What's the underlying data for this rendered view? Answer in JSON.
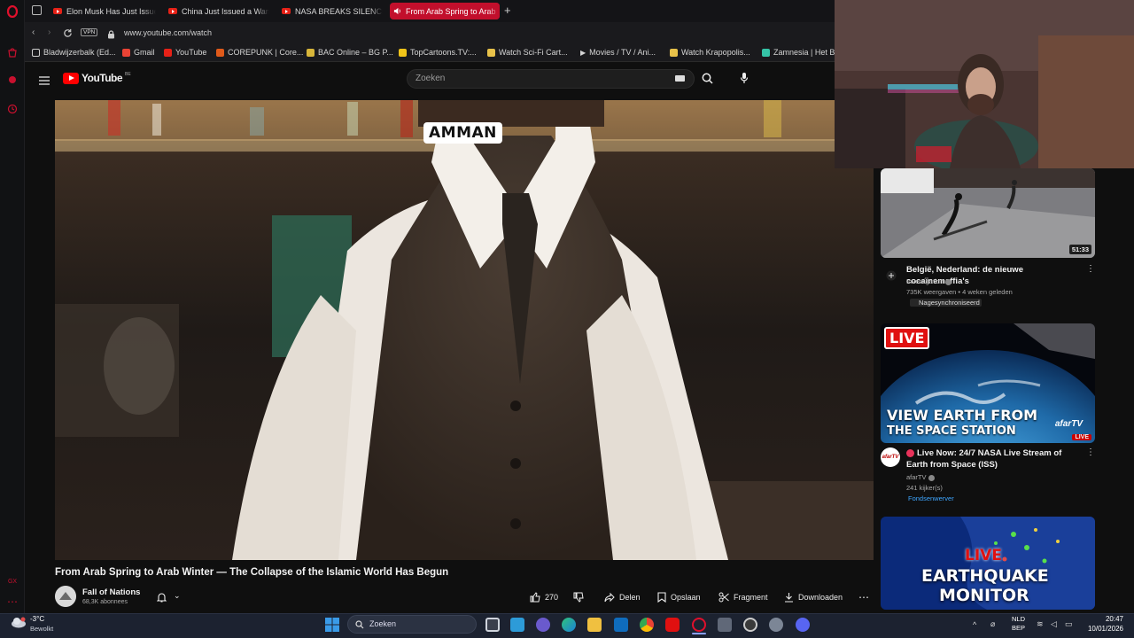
{
  "browser": {
    "tabs": [
      {
        "label": "Elon Musk Has Just Issued",
        "active": false
      },
      {
        "label": "China Just Issued a Warning",
        "active": false
      },
      {
        "label": "NASA BREAKS SILENCE on",
        "active": false
      },
      {
        "label": "From Arab Spring to Arab",
        "active": true
      }
    ],
    "vpn_label": "VPN",
    "url": "www.youtube.com/watch",
    "bookmarks": [
      {
        "label": "Bladwijzerbalk (Ed...",
        "icon": "folder-icon",
        "color": "#cfcfcf"
      },
      {
        "label": "Gmail",
        "icon": "gmail-icon",
        "color": "#ea4335"
      },
      {
        "label": "YouTube",
        "icon": "youtube-icon",
        "color": "#e62117"
      },
      {
        "label": "COREPUNK | Core...",
        "icon": "corepunk-icon",
        "color": "#e05a1a"
      },
      {
        "label": "BAC Online – BG P...",
        "icon": "bac-icon",
        "color": "#d8b63a"
      },
      {
        "label": "TopCartoons.TV:...",
        "icon": "topcartoons-icon",
        "color": "#f0c419"
      },
      {
        "label": "Watch Sci-Fi Cart...",
        "icon": "scifi-icon",
        "color": "#e8c24a"
      },
      {
        "label": "Movies / TV / Ani...",
        "icon": "play-icon",
        "color": "#f1f1f1"
      },
      {
        "label": "Watch Krapopolis...",
        "icon": "krapopolis-icon",
        "color": "#e8c24a"
      },
      {
        "label": "Zamnesia | Het Be",
        "icon": "zamnesia-icon",
        "color": "#35c4a7"
      }
    ]
  },
  "youtube": {
    "logo_text": "YouTube",
    "region_code": "BE",
    "search_placeholder": "Zoeken"
  },
  "video": {
    "overlay_text": "AMMAN",
    "title": "From Arab Spring to Arab Winter — The Collapse of the Islamic World Has Begun",
    "channel_name": "Fall of Nations",
    "subscribers": "68,3K abonnees",
    "likes": "270",
    "share_label": "Delen",
    "save_label": "Opslaan",
    "clip_label": "Fragment",
    "download_label": "Downloaden"
  },
  "recommendations": [
    {
      "title": "België, Nederland: de nieuwe cocaïnemaffia's",
      "channel": "Investigation",
      "meta": "735K weergaven • 4 weken geleden",
      "extra": "Nagesynchroniseerd",
      "duration": "51:33"
    },
    {
      "title": "Live Now: 24/7 NASA Live Stream of Earth from Space (ISS)",
      "channel": "afarTV",
      "meta": "241 kijker(s)",
      "extra": "Fondsenwerver",
      "thumb_badge": "LIVE",
      "thumb_line1": "VIEW EARTH FROM",
      "thumb_line2": "THE SPACE STATION",
      "thumb_brand": "afarTV",
      "thumb_live_tag": "LIVE"
    },
    {
      "thumb_line1": "LIVE",
      "thumb_line2": "EARTHQUAKE",
      "thumb_line3": "MONITOR"
    }
  ],
  "taskbar": {
    "weather_temp": "-3°C",
    "weather_desc": "Bewolkt",
    "search_placeholder": "Zoeken",
    "language_line1": "NLD",
    "language_line2": "BEP",
    "time": "20:47",
    "date": "10/01/2026"
  }
}
